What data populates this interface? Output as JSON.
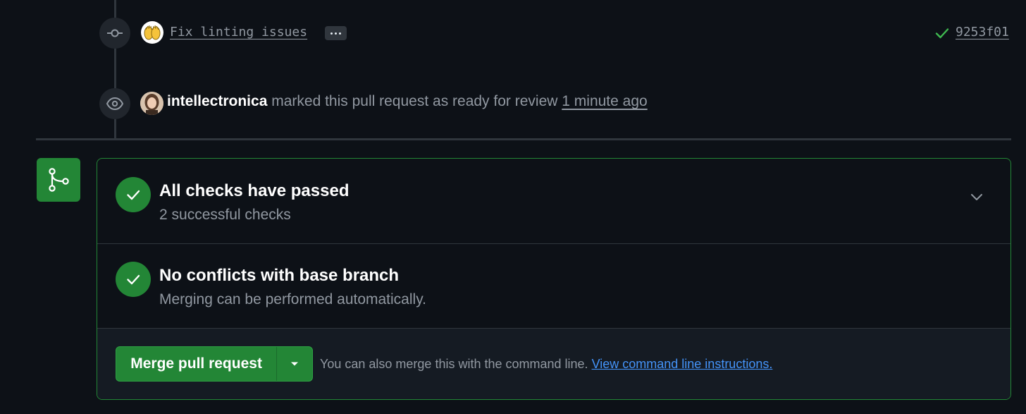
{
  "timeline": {
    "commit": {
      "message": "Fix linting issues",
      "sha": "9253f01",
      "status": "success",
      "icons": [
        "git-commit-icon",
        "raised-hands-emoji",
        "ellipsis-icon",
        "check-icon"
      ]
    },
    "review_event": {
      "user": "intellectronica",
      "action": "marked this pull request as ready for review",
      "time": "1 minute ago",
      "icon": "eye-icon"
    }
  },
  "merge_box": {
    "icon": "git-merge-icon",
    "checks": {
      "title": "All checks have passed",
      "subtitle": "2 successful checks"
    },
    "conflicts": {
      "title": "No conflicts with base branch",
      "subtitle": "Merging can be performed automatically."
    },
    "merge": {
      "button_label": "Merge pull request",
      "hint": "You can also merge this with the command line.",
      "link": "View command line instructions."
    }
  },
  "colors": {
    "background": "#0d1117",
    "success": "#238636",
    "link": "#4493f8",
    "muted": "#9198a1"
  }
}
